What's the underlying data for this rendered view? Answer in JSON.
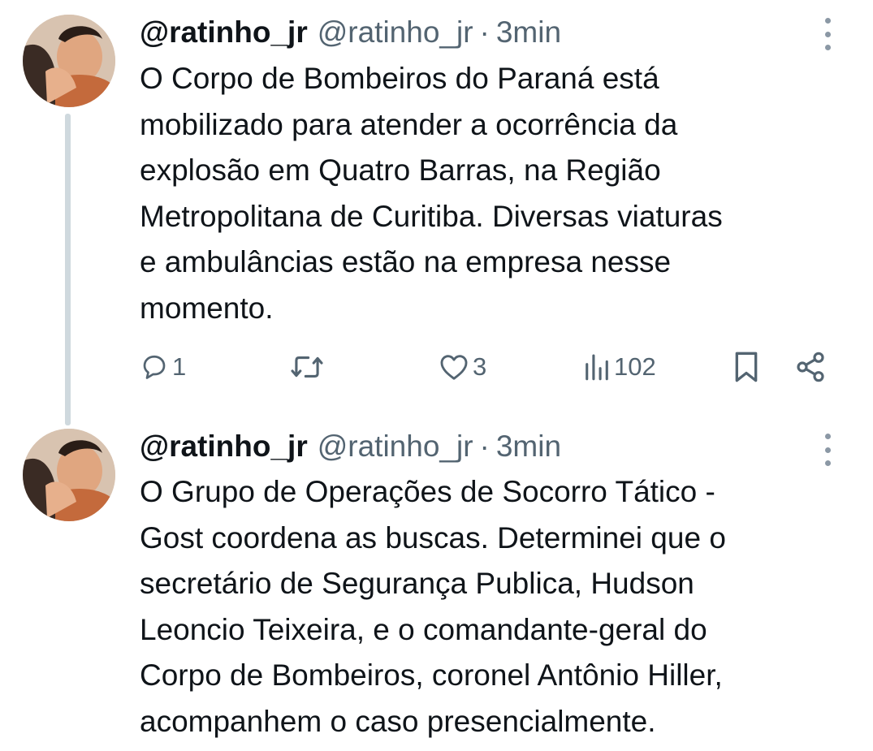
{
  "tweets": [
    {
      "display_name": "@ratinho_jr",
      "handle": "@ratinho_jr",
      "separator": "·",
      "time": "3min",
      "text": "O Corpo de Bombeiros do Paraná está\nmobilizado para atender a ocorrência da\nexplosão em Quatro Barras, na Região\nMetropolitana de Curitiba. Diversas viaturas\ne ambulâncias estão na empresa nesse\nmomento.",
      "actions": {
        "replies": "1",
        "retweets": "",
        "likes": "3",
        "views": "102"
      }
    },
    {
      "display_name": "@ratinho_jr",
      "handle": "@ratinho_jr",
      "separator": "·",
      "time": "3min",
      "text": "O Grupo de Operações de Socorro Tático -\nGost coordena as buscas. Determinei que o\nsecretário de Segurança Publica, Hudson\nLeoncio Teixeira, e o comandante-geral do\nCorpo de Bombeiros, coronel Antônio Hiller,\nacompanhem o caso presencialmente."
    }
  ],
  "colors": {
    "text_primary": "#0f1419",
    "text_secondary": "#536471",
    "thread_line": "#cfd9de",
    "background": "#ffffff"
  },
  "icons": {
    "more": "more-vertical-icon",
    "reply": "reply-icon",
    "retweet": "retweet-icon",
    "like": "heart-icon",
    "views": "views-icon",
    "bookmark": "bookmark-icon",
    "share": "share-icon"
  }
}
